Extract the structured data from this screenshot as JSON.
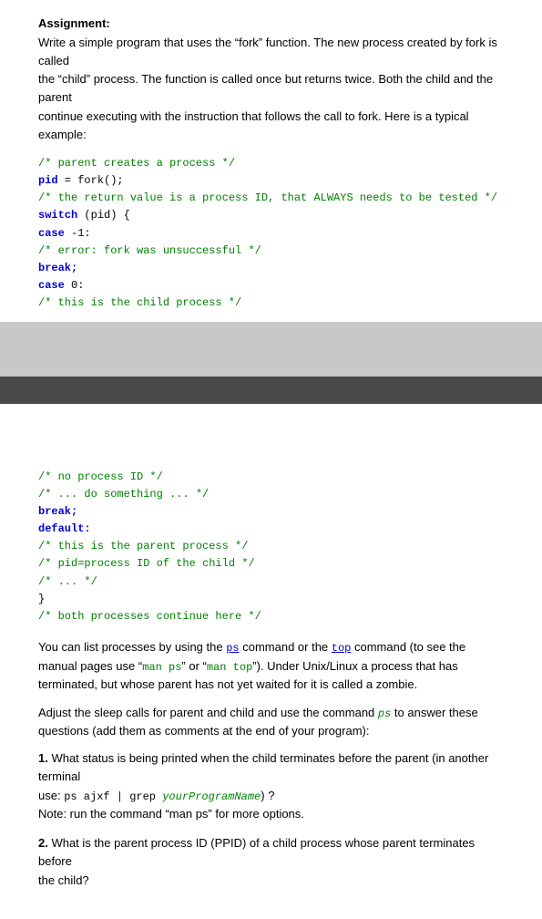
{
  "assignment": {
    "label": "Assignment:",
    "description_line1": "Write a simple program that uses the “fork” function. The new process created by fork is called",
    "description_line2": "the “child” process. The function is called once but returns twice. Both the child and the parent",
    "description_line3": "continue executing with the instruction that follows the call to fork. Here is a typical example:"
  },
  "code_top": [
    {
      "type": "comment",
      "text": "/* parent creates a process */"
    },
    {
      "type": "mixed",
      "parts": [
        {
          "t": "keyword",
          "v": "pid"
        },
        {
          "t": "normal",
          "v": " = fork();"
        }
      ]
    },
    {
      "type": "comment",
      "text": "/* the return value is a process ID, that ALWAYS needs to be tested */"
    },
    {
      "type": "mixed",
      "parts": [
        {
          "t": "keyword",
          "v": "switch"
        },
        {
          "t": "normal",
          "v": " (pid) {"
        }
      ]
    },
    {
      "type": "mixed",
      "parts": [
        {
          "t": "keyword",
          "v": "case"
        },
        {
          "t": "normal",
          "v": " -1:"
        }
      ]
    },
    {
      "type": "comment",
      "text": "/* error: fork was unsuccessful */"
    },
    {
      "type": "keyword",
      "text": "break;"
    },
    {
      "type": "mixed",
      "parts": [
        {
          "t": "keyword",
          "v": "case"
        },
        {
          "t": "normal",
          "v": " 0:"
        }
      ]
    },
    {
      "type": "comment",
      "text": "/* this is the child process */"
    }
  ],
  "code_bottom": [
    {
      "type": "comment",
      "text": "/* no process ID */"
    },
    {
      "type": "comment",
      "text": "/* ... do something ... */"
    },
    {
      "type": "keyword",
      "text": "break;"
    },
    {
      "type": "keyword",
      "text": "default:"
    },
    {
      "type": "comment",
      "text": "/* this is the parent process */"
    },
    {
      "type": "comment",
      "text": "/* pid=process ID of the child */"
    },
    {
      "type": "comment",
      "text": "/* ... */"
    },
    {
      "type": "normal",
      "text": "}"
    },
    {
      "type": "comment",
      "text": "/* both processes continue here */"
    }
  ],
  "body_para1": {
    "prefix": "You can list processes by using the ",
    "ps_link": "ps",
    "middle1": " command or the ",
    "top_link": "top",
    "suffix1": " command (to see the manual pages",
    "line2_pre": "use “",
    "man_ps": "man ps",
    "line2_mid": "” or “",
    "man_top": "man top",
    "line2_suf": "”). Under Unix/Linux a process that has terminated, but whose",
    "line3": "parent has not yet waited for it is called a zombie."
  },
  "body_para2": {
    "text1": "Adjust the sleep calls for parent and child and use the command ",
    "ps_italic": "ps",
    "text2": " to answer these questions",
    "text3": "(add them as comments at the end of your program):"
  },
  "question1": {
    "number": "1.",
    "text1": " What status is being printed when the child terminates before the parent (in another terminal",
    "text2_pre": "use: ps ajxf | grep ",
    "text2_cmd": "yourProgramName",
    "text2_suf": ") ?",
    "text3": "Note: run the command “man ps” for more options."
  },
  "question2": {
    "number": "2.",
    "text1": " What is the parent process ID (PPID) of a child process whose parent terminates before",
    "text2": "the child?"
  }
}
